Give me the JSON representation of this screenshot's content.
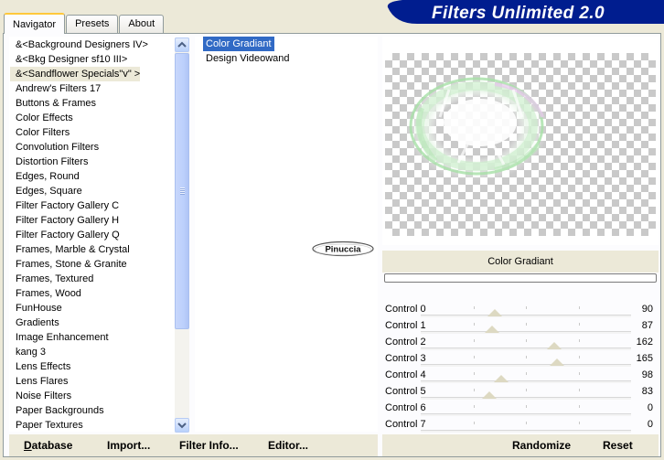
{
  "tabs": [
    {
      "label": "Navigator",
      "active": true
    },
    {
      "label": "Presets",
      "active": false
    },
    {
      "label": "About",
      "active": false
    }
  ],
  "banner": {
    "title": "Filters Unlimited 2.0",
    "color": "#001d8f"
  },
  "categories": {
    "selected_index": 2,
    "items": [
      "&<Background Designers IV>",
      "&<Bkg Designer sf10 III>",
      "&<Sandflower Specials\"v\" >",
      "Andrew's Filters 17",
      "Buttons & Frames",
      "Color Effects",
      "Color Filters",
      "Convolution Filters",
      "Distortion Filters",
      "Edges, Round",
      "Edges, Square",
      "Filter Factory Gallery C",
      "Filter Factory Gallery H",
      "Filter Factory Gallery Q",
      "Frames, Marble & Crystal",
      "Frames, Stone & Granite",
      "Frames, Textured",
      "Frames, Wood",
      "FunHouse",
      "Gradients",
      "Image Enhancement",
      "kang 3",
      "Lens Effects",
      "Lens Flares",
      "Noise Filters",
      "Paper Backgrounds",
      "Paper Textures"
    ]
  },
  "filters": {
    "selected_index": 0,
    "items": [
      "Color Gradiant",
      "Design Videowand"
    ]
  },
  "watermark": "Pinuccia",
  "preview": {
    "filter_name": "Color Gradiant"
  },
  "controls": [
    {
      "label": "Control 0",
      "value": "90",
      "level": 90
    },
    {
      "label": "Control 1",
      "value": "87",
      "level": 87
    },
    {
      "label": "Control 2",
      "value": "162",
      "level": 162
    },
    {
      "label": "Control 3",
      "value": "165",
      "level": 165
    },
    {
      "label": "Control 4",
      "value": "98",
      "level": 98
    },
    {
      "label": "Control 5",
      "value": "83",
      "level": 83
    },
    {
      "label": "Control 6",
      "value": "0",
      "level": 0
    },
    {
      "label": "Control 7",
      "value": "0",
      "level": 0
    }
  ],
  "slider_max": 255,
  "buttons": {
    "database": {
      "key": "D",
      "rest": "atabase"
    },
    "import": {
      "pre": "Import",
      "key": "",
      "label": "Import..."
    },
    "filter_info": {
      "label": "Filter Info..."
    },
    "editor": {
      "label": "Editor..."
    },
    "randomize": "Randomize",
    "reset": "Reset"
  }
}
